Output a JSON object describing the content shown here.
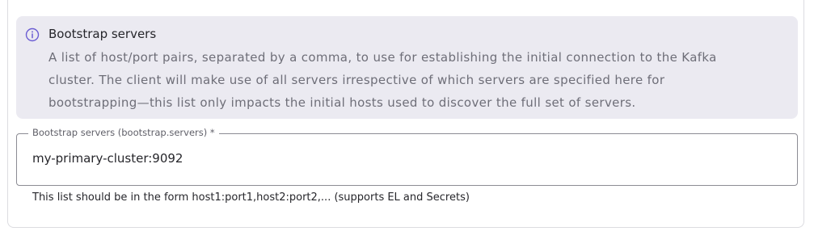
{
  "info": {
    "icon": "info-circle-icon",
    "icon_color": "#6b5dd3",
    "title": "Bootstrap servers",
    "description_line1": "A list of host/port pairs, separated by a comma, to use for establishing the initial connection to the Kafka",
    "description_line2": "cluster. The client will make use of all servers irrespective of which servers are specified here for",
    "description_line3": "bootstrapping—this list only impacts the initial hosts used to discover the full set of servers."
  },
  "field": {
    "label": "Bootstrap servers (bootstrap.servers) *",
    "value": "my-primary-cluster:9092",
    "helper": "This list should be in the form host1:port1,host2:port2,... (supports EL and Secrets)"
  }
}
